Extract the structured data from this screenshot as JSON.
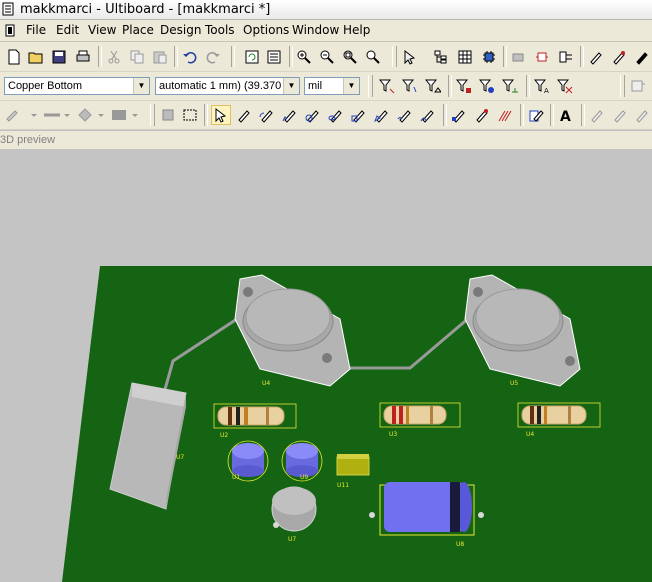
{
  "window": {
    "title": "makkmarci - Ultiboard - [makkmarci *]"
  },
  "menu": {
    "items": [
      {
        "label": "File"
      },
      {
        "label": "Edit"
      },
      {
        "label": "View"
      },
      {
        "label": "Place"
      },
      {
        "label": "Design"
      },
      {
        "label": "Tools"
      },
      {
        "label": "Options"
      },
      {
        "label": "Window"
      },
      {
        "label": "Help"
      }
    ]
  },
  "toolbar": {
    "layer_select": {
      "value": "Copper Bottom"
    },
    "trace_width_select": {
      "value": "automatic 1 mm) (39.370"
    },
    "unit_select": {
      "value": "mil"
    }
  },
  "preview": {
    "label": "3D preview"
  },
  "board": {
    "components": [
      {
        "ref": "U4"
      },
      {
        "ref": "U5"
      },
      {
        "ref": "U2"
      },
      {
        "ref": "U3"
      },
      {
        "ref": "U4"
      },
      {
        "ref": "U1"
      },
      {
        "ref": "U8"
      },
      {
        "ref": "U9"
      },
      {
        "ref": "U11"
      },
      {
        "ref": "U7"
      },
      {
        "ref": "U6"
      }
    ]
  },
  "colors": {
    "pcb": "#146414",
    "viewport_bg": "#c4c4c4",
    "component_gray": "#b8b8b8",
    "capacitor_blue": "#7878f0",
    "silkscreen": "#e8e830"
  }
}
